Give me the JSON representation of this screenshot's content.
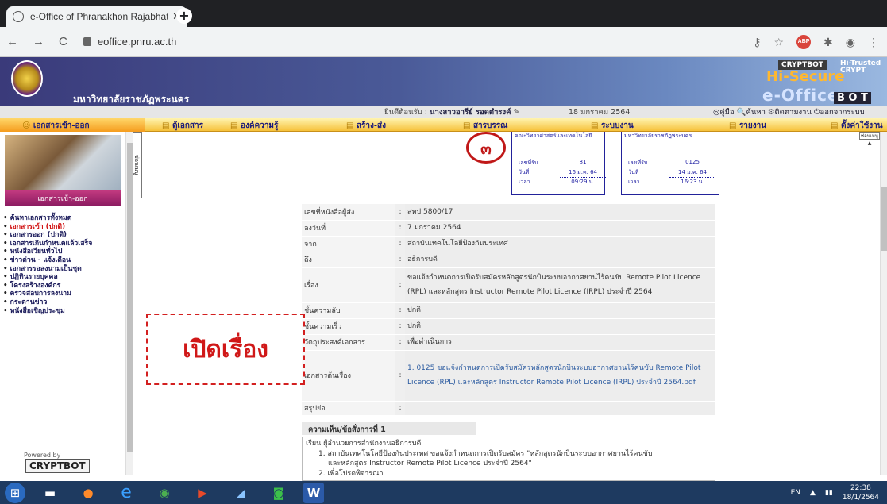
{
  "browser": {
    "tab_title": "e-Office of Phranakhon Rajabhat",
    "tab_close": "✕",
    "new_tab": "+",
    "url": "eoffice.pnru.ac.th"
  },
  "banner": {
    "university": "มหาวิทยาลัยราชภัฏพระนคร",
    "brand_top": "CRYPTBOT",
    "brand_secure": "Hi-Secure",
    "brand_eoffice": "e-Office",
    "brand_right_top": "Hi-Trusted CRYPT",
    "brand_right_bottom": "B O T"
  },
  "info": {
    "welcome": "ยินดีต้อนรับ :",
    "user": "นางสาวอารีย์ รอดตำรงค์",
    "date": "18 มกราคม 2564",
    "tools": "◎คู่มือ  🔍ค้นหา  ⚙ติดตามงาน  ⏻ออกจากระบบ"
  },
  "menu": [
    "เอกสารเข้า-ออก",
    "ตู้เอกสาร",
    "องค์ความรู้",
    "สร้าง-ส่ง",
    "สารบรรณ",
    "ระบบงาน",
    "รายงาน",
    "ตั้งค่าใช้งาน"
  ],
  "sidebar": {
    "header": "เอกสารเข้า-ออก",
    "items": [
      "ค้นหาเอกสารทั้งหมด",
      "เอกสารเข้า (ปกติ)",
      "เอกสารออก (ปกติ)",
      "เอกสารเกินกำหนดแล้วเสร็จ",
      "หนังสือเวียนทั่วไป",
      "ข่าวด่วน - แจ้งเตือน",
      "เอกสารรอลงนามเป็นชุด",
      "ปฏิทินรายบุคคล",
      "โครงสร้างองค์กร",
      "ตรวจสอบการลงนาม",
      "กระดานข่าว",
      "หนังสือเชิญประชุม"
    ],
    "powered": "Powered by",
    "cryptbot": "CRYPTBOT",
    "side_tab": "ซ่อนเมนู",
    "side_tab_right": "ซ่อนเมนู ▲"
  },
  "stamps": [
    {
      "title": "คณะวิทยาศาสตร์และเทคโนโลยี",
      "no_label": "เลขที่รับ",
      "no": "81",
      "date_label": "วันที่",
      "date": "16 ม.ค. 64",
      "time_label": "เวลา",
      "time": "09:29 น."
    },
    {
      "title": "มหาวิทยาลัยราชภัฏพระนคร",
      "no_label": "เลขที่รับ",
      "no": "0125",
      "date_label": "วันที่",
      "date": "14 ม.ค. 64",
      "time_label": "เวลา",
      "time": "16:23 น."
    }
  ],
  "annotation_number": "๓",
  "details": [
    {
      "label": "เลขที่หนังสือผู้ส่ง",
      "value": "สทป 5800/17"
    },
    {
      "label": "ลงวันที่",
      "value": "7 มกราคม 2564"
    },
    {
      "label": "จาก",
      "value": "สถาบันเทคโนโลยีป้องกันประเทศ"
    },
    {
      "label": "ถึง",
      "value": "อธิการบดี"
    },
    {
      "label": "เรื่อง",
      "value": "ขอแจ้งกำหนดการเปิดรับสมัครหลักสูตรนักบินระบบอากาศยานไร้คนขับ Remote Pilot Licence (RPL) และหลักสูตร Instructor Remote Pilot Licence (IRPL) ประจำปี 2564"
    },
    {
      "label": "ชั้นความลับ",
      "value": "ปกติ"
    },
    {
      "label": "ชั้นความเร็ว",
      "value": "ปกติ"
    },
    {
      "label": "วัตถุประสงค์เอกสาร",
      "value": "เพื่อดำเนินการ"
    },
    {
      "label": "เอกสารต้นเรื่อง",
      "value": "1. 0125 ขอแจ้งกำหนดการเปิดรับสมัครหลักสูตรนักบินระบบอากาศยานไร้คนขับ Remote Pilot Licence (RPL) และหลักสูตร Instructor Remote Pilot Licence (IRPL) ประจำปี 2564.pdf"
    },
    {
      "label": "สรุปย่อ",
      "value": ""
    }
  ],
  "comments": {
    "header": "ความเห็น/ข้อสั่งการที่ 1",
    "line1": "เรียน  ผู้อำนวยการสำนักงานอธิการบดี",
    "line2": "1. สถาบันเทคโนโลยีป้องกันประเทศ  ขอแจ้งกำหนดการเปิดรับสมัคร \"หลักสูตรนักบินระบบอากาศยานไร้คนขับ",
    "line3": "และหลักสูตร Instructor Remote Pilot Licence ประจำปี 2564\"",
    "line4": "2. เพื่อโปรดพิจารณา"
  },
  "overlay": "เปิดเรื่อง",
  "taskbar": {
    "lang": "EN",
    "time": "22:38",
    "date": "18/1/2564"
  }
}
